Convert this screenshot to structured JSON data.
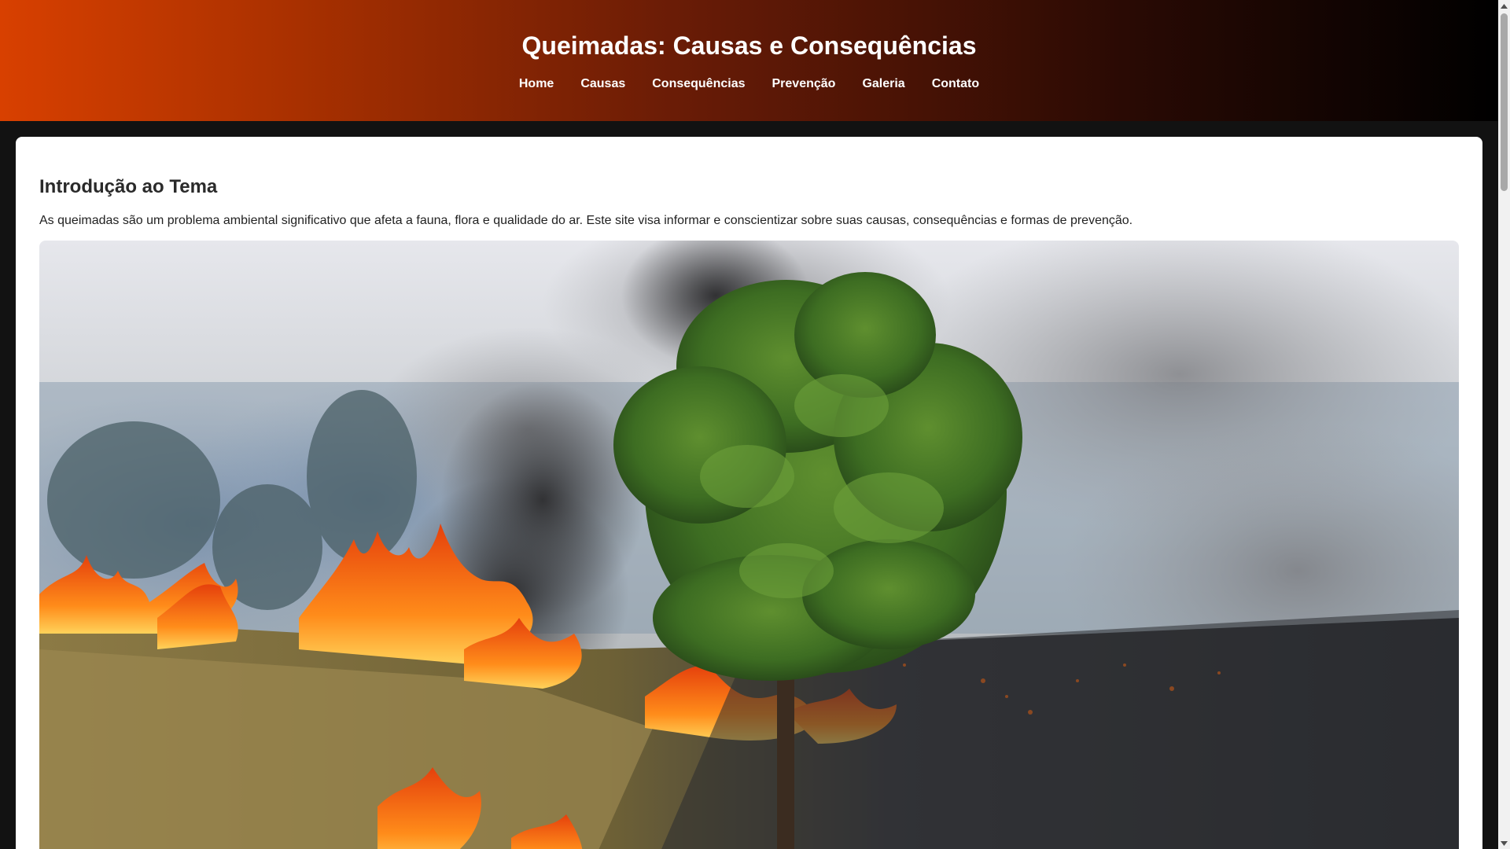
{
  "header": {
    "title": "Queimadas: Causas e Consequências",
    "nav": [
      {
        "label": "Home"
      },
      {
        "label": "Causas"
      },
      {
        "label": "Consequências"
      },
      {
        "label": "Prevenção"
      },
      {
        "label": "Galeria"
      },
      {
        "label": "Contato"
      }
    ]
  },
  "main": {
    "section_title": "Introdução ao Tema",
    "intro_text": "As queimadas são um problema ambiental significativo que afeta a fauna, flora e qualidade do ar. Este site visa informar e conscientizar sobre suas causas, consequências e formas de prevenção.",
    "hero_image": {
      "subject": "grassland-fire-with-pine-tree"
    }
  },
  "colors": {
    "header_gradient_start": "#d84000",
    "header_gradient_end": "#000000",
    "page_background": "#121212",
    "card_background": "#ffffff"
  },
  "scrollbar": {
    "up_icon": "triangle-up-icon",
    "down_icon": "triangle-down-icon"
  }
}
